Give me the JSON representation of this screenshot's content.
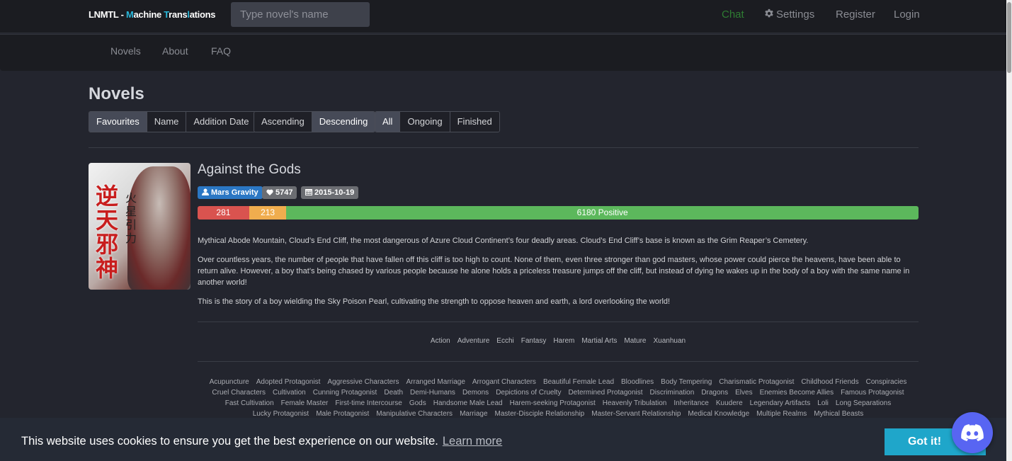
{
  "topbar": {
    "brand": {
      "prefix": "LNMTL - ",
      "m": "M",
      "achine": "achine ",
      "t": "T",
      "rans": "rans",
      "l": "l",
      "ations": "ations"
    },
    "search_placeholder": "Type novel's name",
    "links": {
      "chat": "Chat",
      "settings": "Settings",
      "register": "Register",
      "login": "Login"
    },
    "colors": {
      "accent": "#29b6d8",
      "chat": "#2e7d32"
    }
  },
  "subnav": {
    "items": [
      "Novels",
      "About",
      "FAQ"
    ]
  },
  "main": {
    "title": "Novels",
    "sort_group": [
      {
        "label": "Favourites",
        "active": true
      },
      {
        "label": "Name",
        "active": false
      },
      {
        "label": "Addition Date",
        "active": false
      }
    ],
    "order_group": [
      {
        "label": "Ascending",
        "active": false
      },
      {
        "label": "Descending",
        "active": true
      }
    ],
    "status_group": [
      {
        "label": "All",
        "active": true
      },
      {
        "label": "Ongoing",
        "active": false
      },
      {
        "label": "Finished",
        "active": false
      }
    ]
  },
  "novel": {
    "title": "Against the Gods",
    "cover_text": {
      "main": "逆天邪神",
      "author": "火星引力"
    },
    "author": "Mars Gravity",
    "favourites": "5747",
    "date": "2015-10-19",
    "rating": {
      "negative": 281,
      "neutral": 213,
      "positive": 6180,
      "positive_label": "6180 Positive",
      "colors": {
        "negative": "#d9534f",
        "neutral": "#f0ad4e",
        "positive": "#5cb85c"
      }
    },
    "description": [
      "Mythical Abode Mountain, Cloud’s End Cliff, the most dangerous of Azure Cloud Continent’s four deadly areas. Cloud’s End Cliff’s base is known as the Grim Reaper’s Cemetery.",
      "Over countless years, the number of people that have fallen off this cliff is too high to count. None of them, even three stronger than god masters, whose power could pierce the heavens, have been able to return alive. However, a boy that’s being chased by various people because he alone holds a priceless treasure jumps off the cliff, but instead of dying he wakes up in the body of a boy with the same name in another world!",
      "This is the story of a boy wielding the Sky Poison Pearl, cultivating the strength to oppose heaven and earth, a lord overlooking the world!"
    ],
    "genres": [
      "Action",
      "Adventure",
      "Ecchi",
      "Fantasy",
      "Harem",
      "Martial Arts",
      "Mature",
      "Xuanhuan"
    ],
    "tags": [
      "Acupuncture",
      "Adopted Protagonist",
      "Aggressive Characters",
      "Arranged Marriage",
      "Arrogant Characters",
      "Beautiful Female Lead",
      "Bloodlines",
      "Body Tempering",
      "Charismatic Protagonist",
      "Childhood Friends",
      "Conspiracies",
      "Cruel Characters",
      "Cultivation",
      "Cunning Protagonist",
      "Death",
      "Demi-Humans",
      "Demons",
      "Depictions of Cruelty",
      "Determined Protagonist",
      "Discrimination",
      "Dragons",
      "Elves",
      "Enemies Become Allies",
      "Famous Protagonist",
      "Fast Cultivation",
      "Female Master",
      "First-time Intercourse",
      "Gods",
      "Handsome Male Lead",
      "Harem-seeking Protagonist",
      "Heavenly Tribulation",
      "Inheritance",
      "Kuudere",
      "Legendary Artifacts",
      "Loli",
      "Long Separations",
      "Lucky Protagonist",
      "Male Protagonist",
      "Manipulative Characters",
      "Marriage",
      "Master-Disciple Relationship",
      "Master-Servant Relationship",
      "Medical Knowledge",
      "Multiple Realms",
      "Mythical Beasts"
    ]
  },
  "cookie": {
    "message": "This website uses cookies to ensure you get the best experience on our website.",
    "learn_more": "Learn more",
    "button": "Got it!"
  },
  "discord": {
    "icon": "discord-icon",
    "color": "#5865f2"
  }
}
